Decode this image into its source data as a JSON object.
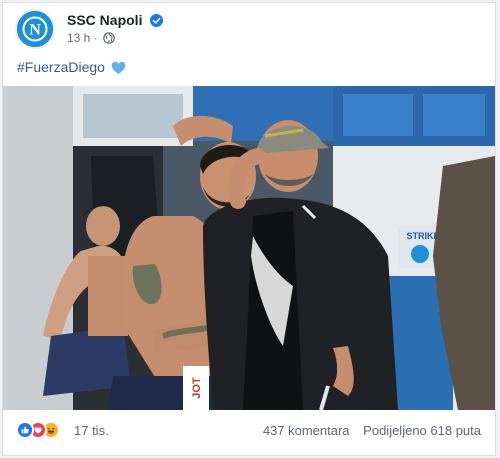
{
  "post": {
    "page_name": "SSC Napoli",
    "timestamp": "13 h",
    "separator": "·",
    "text": "#FuerzaDiego",
    "avatar_letter": "N",
    "brand_color": "#1e90d6",
    "verified_color": "#1877f2"
  },
  "footer": {
    "reaction_icons": [
      "like-icon",
      "love-icon",
      "haha-icon"
    ],
    "reaction_count": "17 tis.",
    "comments": "437 komentara",
    "shares": "Podijeljeno 618 puta"
  },
  "photo": {
    "jersey_text": "STRIKE",
    "shorts_text": "JOT"
  }
}
